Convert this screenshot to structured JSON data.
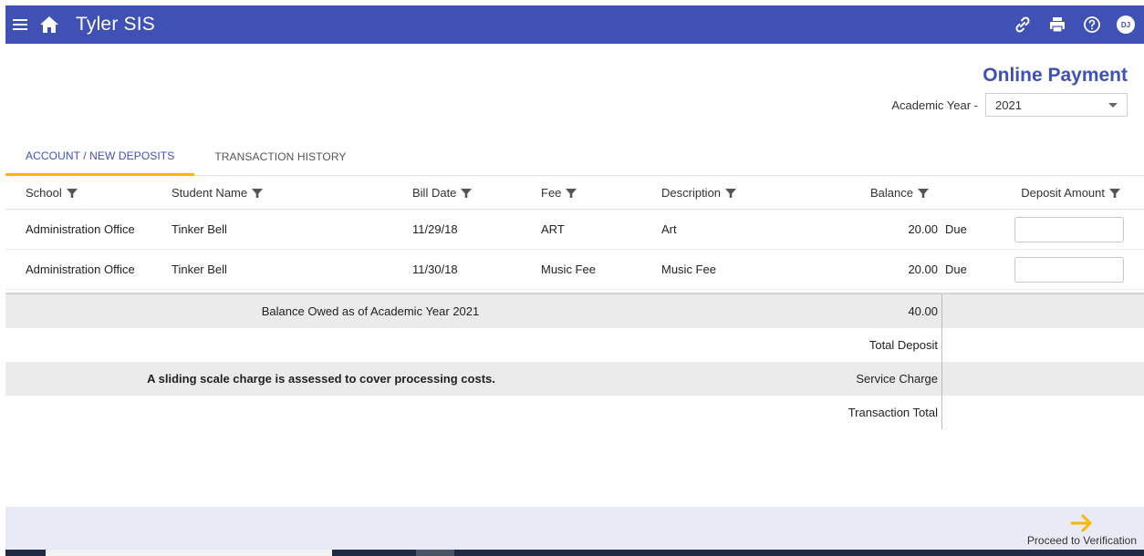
{
  "app": {
    "title": "Tyler SIS",
    "avatar_initials": "DJ",
    "brand_color": "#3f51b5",
    "accent_color": "#f5b900"
  },
  "icons": {
    "menu": "menu-icon",
    "home": "home-icon",
    "link": "link-icon",
    "print": "print-icon",
    "help": "help-icon"
  },
  "page": {
    "title": "Online Payment",
    "academic_year_label": "Academic Year -",
    "academic_year_value": "2021"
  },
  "tabs": [
    {
      "label": "ACCOUNT / NEW DEPOSITS",
      "active": true
    },
    {
      "label": "TRANSACTION HISTORY",
      "active": false
    }
  ],
  "table": {
    "columns": {
      "school": "School",
      "student_name": "Student Name",
      "bill_date": "Bill Date",
      "fee": "Fee",
      "description": "Description",
      "balance": "Balance",
      "deposit_amount": "Deposit Amount"
    },
    "rows": [
      {
        "school": "Administration Office",
        "student_name": "Tinker Bell",
        "bill_date": "11/29/18",
        "fee": "ART",
        "description": "Art",
        "balance": "20.00",
        "status": "Due",
        "deposit": ""
      },
      {
        "school": "Administration Office",
        "student_name": "Tinker Bell",
        "bill_date": "11/30/18",
        "fee": "Music Fee",
        "description": "Music Fee",
        "balance": "20.00",
        "status": "Due",
        "deposit": ""
      }
    ]
  },
  "summary": {
    "balance_owed_label": "Balance Owed as of Academic Year 2021",
    "balance_owed_value": "40.00",
    "total_deposit_label": "Total Deposit",
    "notice": "A sliding scale charge is assessed to cover processing costs.",
    "service_charge_label": "Service Charge",
    "transaction_total_label": "Transaction Total"
  },
  "footer": {
    "proceed_label": "Proceed to Verification"
  }
}
